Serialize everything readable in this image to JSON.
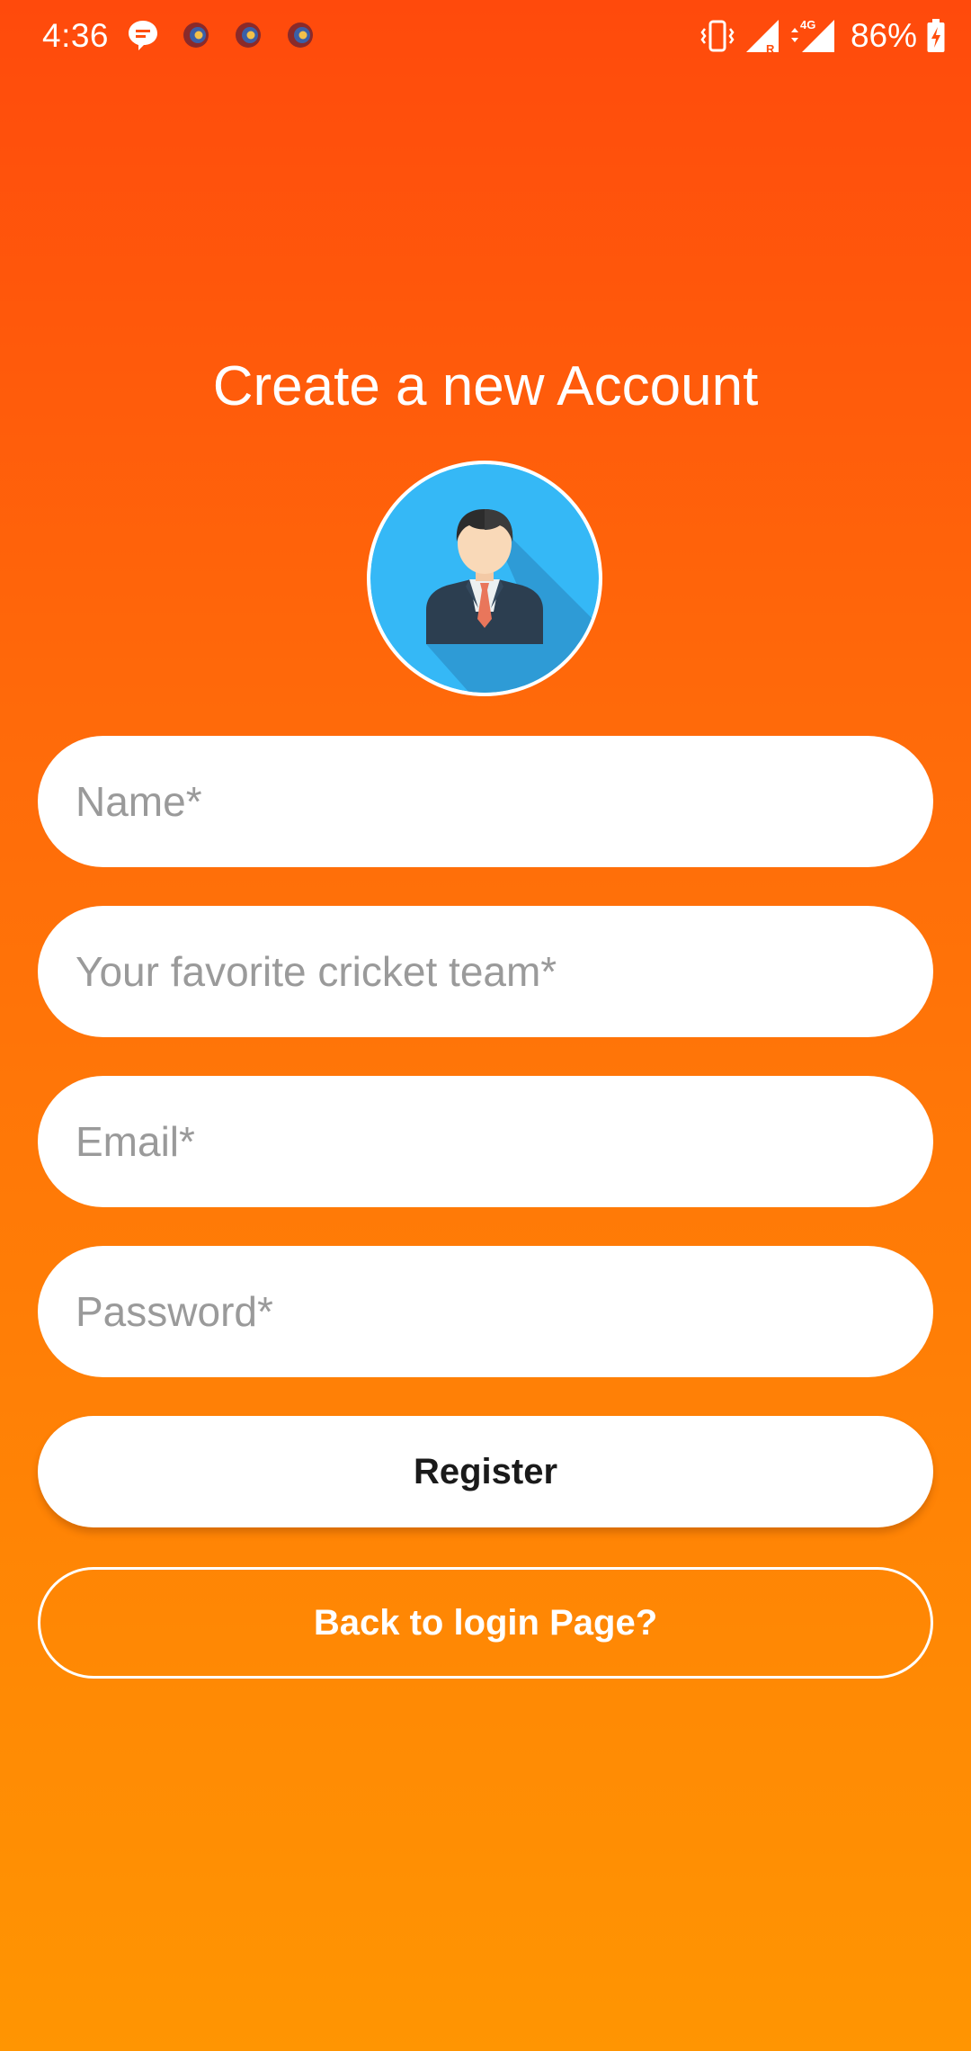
{
  "status_bar": {
    "time": "4:36",
    "battery_percent": "86%",
    "notification_icons": [
      "message-bubble-icon",
      "app-notification-icon",
      "app-notification-icon",
      "app-notification-icon"
    ],
    "right_icons": [
      "vibrate-icon",
      "signal-roaming-icon",
      "signal-4g-icon",
      "battery-charging-icon"
    ],
    "network_label": "4G",
    "roaming_label": "R"
  },
  "title": "Create a new Account",
  "avatar": {
    "icon": "user-avatar-icon",
    "background_color": "#35B8F6"
  },
  "form": {
    "name_placeholder": "Name*",
    "team_placeholder": "Your favorite cricket team*",
    "email_placeholder": "Email*",
    "password_placeholder": "Password*"
  },
  "buttons": {
    "register_label": "Register",
    "back_label": "Back to login Page?"
  },
  "colors": {
    "gradient_top": "#FF4A0C",
    "gradient_bottom": "#FF9502",
    "field_background": "#FFFFFF",
    "placeholder": "#9A9A9A"
  }
}
